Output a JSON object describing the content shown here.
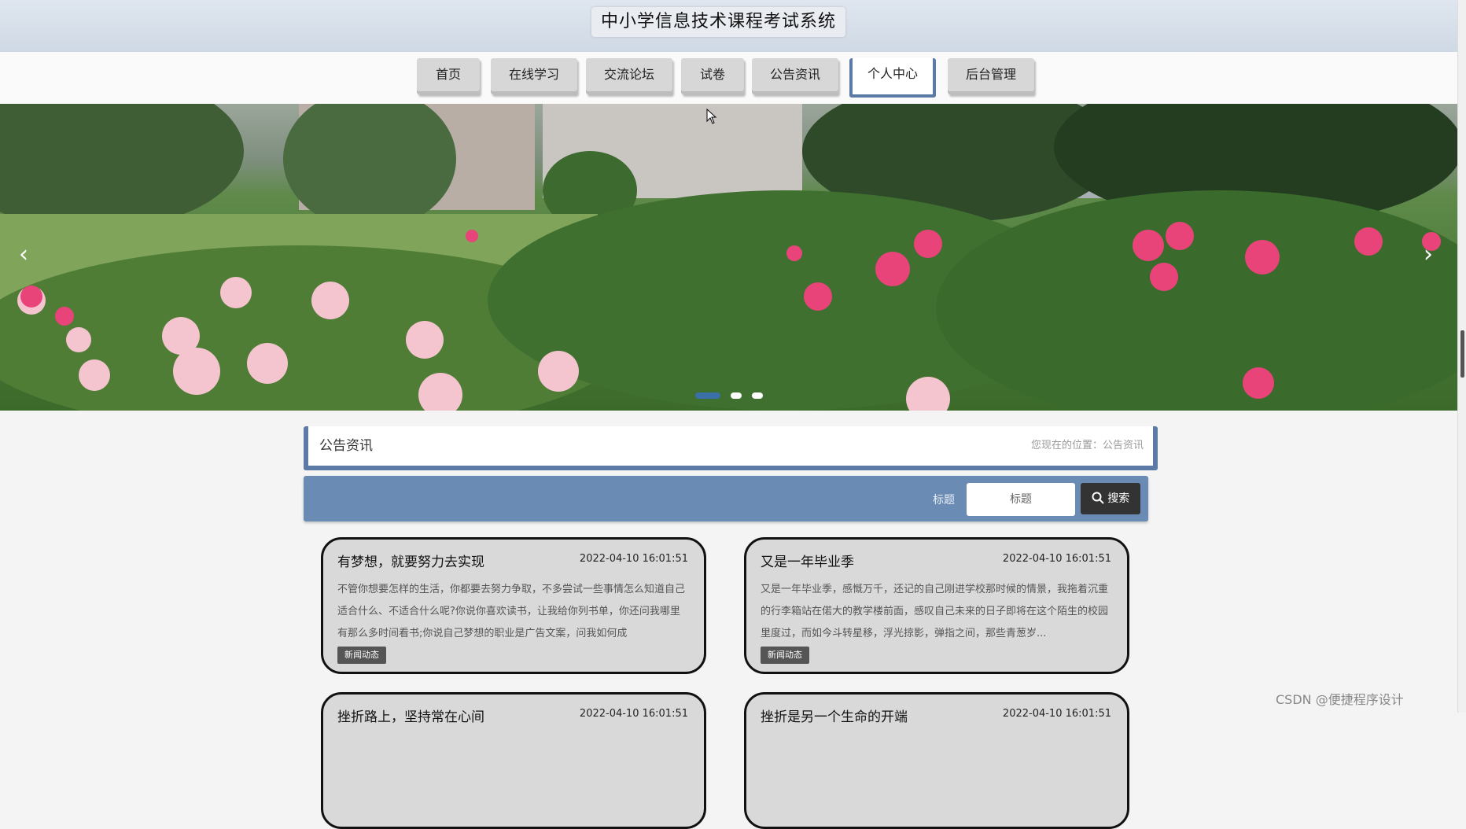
{
  "header": {
    "site_title": "中小学信息技术课程考试系统"
  },
  "nav": {
    "items": [
      {
        "label": "首页"
      },
      {
        "label": "在线学习"
      },
      {
        "label": "交流论坛"
      },
      {
        "label": "试卷"
      },
      {
        "label": "公告资讯"
      },
      {
        "label": "个人中心",
        "active": true
      },
      {
        "label": "后台管理"
      }
    ]
  },
  "carousel": {
    "prev_icon": "‹",
    "next_icon": "›",
    "slide_count": 3,
    "active_slide": 1
  },
  "breadcrumb": {
    "title": "公告资讯",
    "location": "您现在的位置：公告资讯"
  },
  "search": {
    "label": "标题",
    "placeholder": "标题",
    "button_label": "搜索"
  },
  "news": [
    {
      "title": "有梦想，就要努力去实现",
      "time": "2022-04-10 16:01:51",
      "summary": "不管你想要怎样的生活，你都要去努力争取，不多尝试一些事情怎么知道自己适合什么、不适合什么呢?你说你喜欢读书，让我给你列书单，你还问我哪里有那么多时间看书;你说自己梦想的职业是广告文案，问我如何成",
      "tag": "新闻动态"
    },
    {
      "title": "又是一年毕业季",
      "time": "2022-04-10 16:01:51",
      "summary": "又是一年毕业季，感慨万千，还记的自己刚进学校那时候的情景，我拖着沉重的行李箱站在偌大的教学楼前面，感叹自己未来的日子即将在这个陌生的校园里度过，而如今斗转星移，浮光掠影，弹指之间，那些青葱岁...",
      "tag": "新闻动态"
    },
    {
      "title": "挫折路上，坚持常在心间",
      "time": "2022-04-10 16:01:51"
    },
    {
      "title": "挫折是另一个生命的开端",
      "time": "2022-04-10 16:01:51"
    }
  ],
  "watermark": "CSDN @便捷程序设计",
  "colors": {
    "accent": "#5b7aa6",
    "search_bar": "#6a8bb3",
    "card_bg": "#d9d9d9"
  }
}
